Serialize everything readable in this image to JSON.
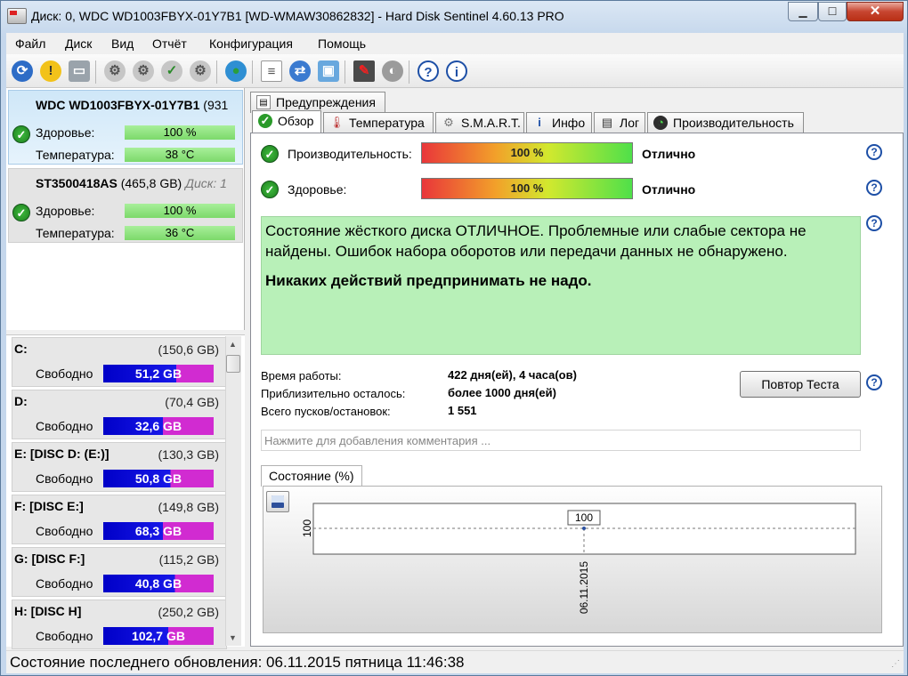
{
  "window": {
    "title": "Диск: 0, WDC WD1003FBYX-01Y7B1 [WD-WMAW30862832]  -  Hard Disk Sentinel 4.60.13 PRO",
    "min_icon": "minimize-icon",
    "max_icon": "maximize-icon",
    "close_label": "✕"
  },
  "menu": [
    "Файл",
    "Диск",
    "Вид",
    "Отчёт",
    "Конфигурация",
    "Помощь"
  ],
  "toolbar": {
    "icons": [
      "refresh-icon",
      "alert-icon",
      "disk-icon",
      "disk-test-icon",
      "disk-check-icon",
      "disk-ok-icon",
      "disk-scan-icon",
      "globe-icon",
      "report-icon",
      "sync-icon",
      "network-icon",
      "settings-icon",
      "speaker-icon",
      "help-icon",
      "info-icon"
    ]
  },
  "disks": [
    {
      "name": "WDC WD1003FBYX-01Y7B1",
      "size": "(931",
      "disk_no": "",
      "health_label": "Здоровье:",
      "health": "100 %",
      "temp_label": "Температура:",
      "temp": "38 °C"
    },
    {
      "name": "ST3500418AS",
      "size": "(465,8 GB)",
      "disk_no": "Диск: 1",
      "health_label": "Здоровье:",
      "health": "100 %",
      "temp_label": "Температура:",
      "temp": "36 °C"
    }
  ],
  "volumes": [
    {
      "name": "C:",
      "size": "(150,6 GB)",
      "free_label": "Свободно",
      "free": "51,2 GB",
      "free_fraction": 0.34
    },
    {
      "name": "D:",
      "size": "(70,4 GB)",
      "free_label": "Свободно",
      "free": "32,6 GB",
      "free_fraction": 0.46
    },
    {
      "name": "E: [DISC D: (E:)]",
      "size": "(130,3 GB)",
      "free_label": "Свободно",
      "free": "50,8 GB",
      "free_fraction": 0.39
    },
    {
      "name": "F: [DISC E:]",
      "size": "(149,8 GB)",
      "free_label": "Свободно",
      "free": "68,3 GB",
      "free_fraction": 0.46
    },
    {
      "name": "G: [DISC F:]",
      "size": "(115,2 GB)",
      "free_label": "Свободно",
      "free": "40,8 GB",
      "free_fraction": 0.35
    },
    {
      "name": "H: [DISC H]",
      "size": "(250,2 GB)",
      "free_label": "Свободно",
      "free": "102,7 GB",
      "free_fraction": 0.41
    }
  ],
  "tabs_top": [
    "Предупреждения"
  ],
  "tabs": [
    {
      "label": "Обзор",
      "icon": "check-icon"
    },
    {
      "label": "Температура",
      "icon": "thermometer-icon"
    },
    {
      "label": "S.M.A.R.T.",
      "icon": "smart-icon"
    },
    {
      "label": "Инфо",
      "icon": "info-icon"
    },
    {
      "label": "Лог",
      "icon": "log-icon"
    },
    {
      "label": "Производительность",
      "icon": "performance-icon"
    }
  ],
  "overview": {
    "perf_label": "Производительность:",
    "perf_value": "100 %",
    "perf_rating": "Отлично",
    "health_label": "Здоровье:",
    "health_value": "100 %",
    "health_rating": "Отлично",
    "status_text_1": "Состояние жёсткого диска ОТЛИЧНОЕ. Проблемные или слабые сектора не найдены. Ошибок набора оборотов или передачи данных не обнаружено.",
    "status_text_2": "Никаких действий предпринимать не надо.",
    "uptime_label": "Время работы:",
    "uptime_value": "422 дня(ей), 4 часа(ов)",
    "remaining_label": "Приблизительно осталось:",
    "remaining_value": "более 1000 дня(ей)",
    "starts_label": "Всего пусков/остановок:",
    "starts_value": "1 551",
    "retest_button": "Повтор Теста",
    "comment_placeholder": "Нажмите для добавления комментария ..."
  },
  "chart_tab_label": "Состояние (%)",
  "chart_data": {
    "type": "line",
    "x": [
      "06.11.2015"
    ],
    "series": [
      {
        "values": [
          100
        ]
      }
    ],
    "title": "",
    "xlabel": "",
    "ylabel": "",
    "y_tick_label": "100",
    "data_labels": [
      "100"
    ]
  },
  "statusbar": {
    "text": "Состояние последнего обновления: 06.11.2015 пятница 11:46:38"
  }
}
